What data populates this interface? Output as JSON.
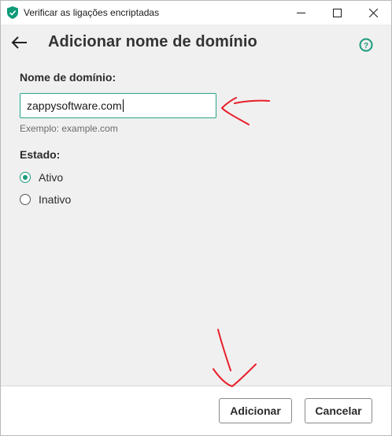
{
  "window": {
    "title": "Verificar as ligações encriptadas",
    "minimize_icon": "minimize-icon",
    "maximize_icon": "maximize-icon",
    "close_icon": "close-icon"
  },
  "header": {
    "title": "Adicionar nome de domínio",
    "back_icon": "back-arrow-icon",
    "help_icon": "help-icon"
  },
  "form": {
    "domain_label": "Nome de domínio:",
    "domain_value": "zappysoftware.com",
    "domain_hint": "Exemplo: example.com",
    "state_label": "Estado:",
    "state_options": [
      {
        "label": "Ativo",
        "selected": true
      },
      {
        "label": "Inativo",
        "selected": false
      }
    ]
  },
  "footer": {
    "add_label": "Adicionar",
    "cancel_label": "Cancelar"
  },
  "colors": {
    "accent": "#1c9a7c",
    "annotation": "#e8202a"
  }
}
